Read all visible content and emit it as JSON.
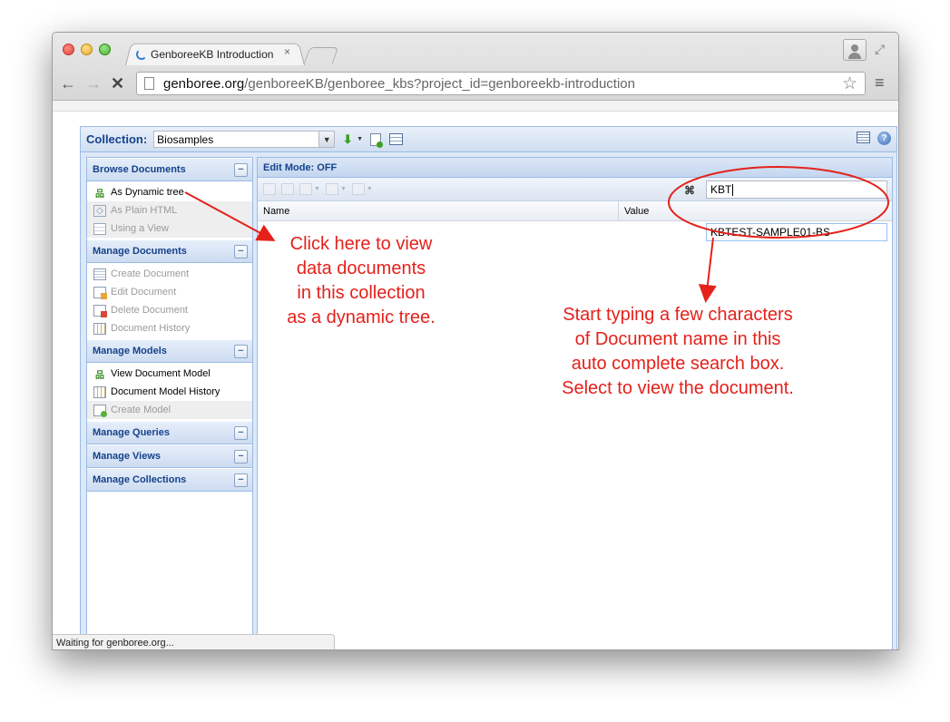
{
  "browser": {
    "tab_title": "GenboreeKB Introduction",
    "tab_close": "×",
    "url_host": "genboree.org",
    "url_path": "/genboreeKB/genboree_kbs?project_id=genboreekb-introduction",
    "status_text": "Waiting for genboree.org..."
  },
  "toolbar": {
    "collection_label": "Collection:",
    "collection_value": "Biosamples"
  },
  "sidebar": {
    "sections": [
      {
        "title": "Browse Documents",
        "items": [
          {
            "label": "As Dynamic tree",
            "icon": "tree-icon",
            "enabled": true
          },
          {
            "label": "As Plain HTML",
            "icon": "html-icon",
            "enabled": false
          },
          {
            "label": "Using a View",
            "icon": "view-icon",
            "enabled": false
          }
        ]
      },
      {
        "title": "Manage Documents",
        "items": [
          {
            "label": "Create Document",
            "icon": "document-icon",
            "enabled": false
          },
          {
            "label": "Edit Document",
            "icon": "edit-document-icon",
            "enabled": false
          },
          {
            "label": "Delete Document",
            "icon": "delete-document-icon",
            "enabled": false
          },
          {
            "label": "Document History",
            "icon": "history-icon",
            "enabled": false
          }
        ]
      },
      {
        "title": "Manage Models",
        "items": [
          {
            "label": "View Document Model",
            "icon": "tree-icon",
            "enabled": true
          },
          {
            "label": "Document Model History",
            "icon": "history-icon",
            "enabled": true
          },
          {
            "label": "Create Model",
            "icon": "new-model-icon",
            "enabled": false
          }
        ]
      },
      {
        "title": "Manage Queries",
        "items": []
      },
      {
        "title": "Manage Views",
        "items": []
      },
      {
        "title": "Manage Collections",
        "items": []
      }
    ],
    "toggle_glyph": "−"
  },
  "main": {
    "edit_mode": "Edit Mode: OFF",
    "search_value": "KBT",
    "suggestion": "KBTEST-SAMPLE01-BS",
    "columns": [
      "Name",
      "Value"
    ]
  },
  "annotations": {
    "tree_hint": [
      "Click here to view",
      "data documents",
      "in this collection",
      "as a dynamic tree."
    ],
    "search_hint": [
      "Start typing a few characters",
      "of Document name in this",
      "auto complete search box.",
      "Select to view the document."
    ],
    "color": "#e4211b"
  }
}
